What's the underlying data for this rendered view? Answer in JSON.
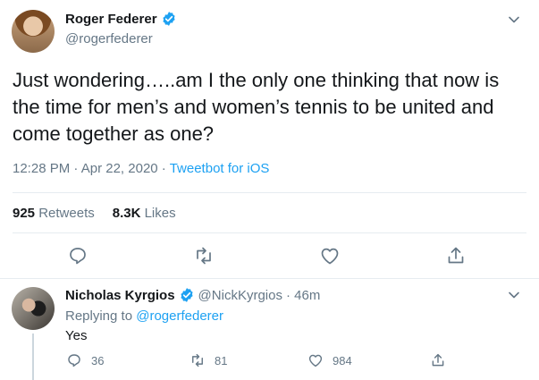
{
  "tweet": {
    "display_name": "Roger Federer",
    "handle": "@rogerfederer",
    "text": "Just wondering…..am I the only one thinking that now is the time for men’s and women’s tennis to be united and come together as one?",
    "time": "12:28 PM",
    "separator": " · ",
    "date": "Apr 22, 2020",
    "source": "Tweetbot for iOS",
    "retweets_count": "925",
    "retweets_label": "Retweets",
    "likes_count": "8.3K",
    "likes_label": "Likes"
  },
  "reply": {
    "display_name": "Nicholas Kyrgios",
    "handle": "@NickKyrgios",
    "age": "· 46m",
    "replying_prefix": "Replying to ",
    "replying_to": "@rogerfederer",
    "text": "Yes",
    "reply_count": "36",
    "retweet_count": "81",
    "like_count": "984"
  },
  "icons": {
    "verified": "verified-badge-icon",
    "chevron": "chevron-down-icon",
    "reply": "reply-bubble-icon",
    "retweet": "retweet-icon",
    "like": "heart-icon",
    "share": "share-icon"
  },
  "colors": {
    "accent": "#1da1f2",
    "text": "#14171a",
    "muted": "#657786",
    "divider": "#e6ecf0"
  }
}
